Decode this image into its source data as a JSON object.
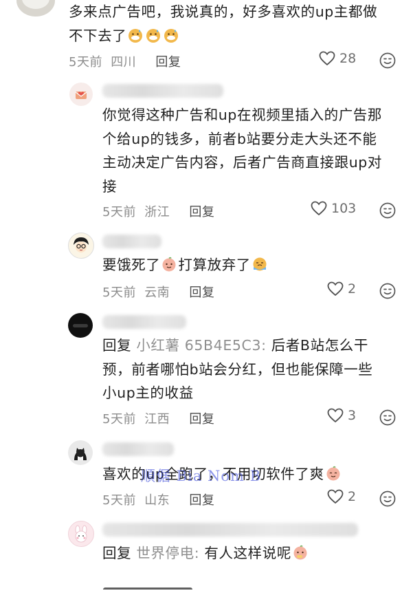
{
  "comments": [
    {
      "text_line1": "多来点广告吧，我说真的，好多喜欢的up主都做",
      "text_line2": "不下去了",
      "time": "5天前",
      "location": "四川",
      "reply_label": "回复",
      "likes": "28"
    },
    {
      "text_lines": [
        "你觉得这种广告和up在视频里插入的广告那",
        "个给up的钱多，前者b站要分走大头还不能",
        "主动决定广告内容，后者广告商直接跟up对",
        "接"
      ],
      "time": "5天前",
      "location": "浙江",
      "reply_label": "回复",
      "likes": "103"
    },
    {
      "text_a": "要饿死了",
      "text_b": "打算放弃了",
      "time": "5天前",
      "location": "云南",
      "reply_label": "回复",
      "likes": "2"
    },
    {
      "reply_prefix": "回复",
      "mention": "小红薯 65B4E5C3:",
      "text_line1": " 后者B站怎么干",
      "text_line2": "预，前者哪怕b站会分红，但也能保障一些",
      "text_line3": "小up主的收益",
      "time": "5天前",
      "location": "江西",
      "reply_label": "回复",
      "likes": "3"
    },
    {
      "text": "喜欢的up全跑了，不用切软件了爽",
      "time": "5天前",
      "location": "山东",
      "reply_label": "回复",
      "likes": "2"
    },
    {
      "reply_prefix": "回复",
      "mention": "世界停电:",
      "text": " 有人这样说呢"
    }
  ],
  "watermark": "順倨 Bia Nom B"
}
